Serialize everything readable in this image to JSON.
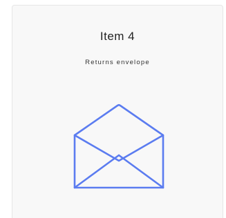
{
  "card": {
    "title": "Item 4",
    "subtitle": "Returns envelope",
    "icon": "envelope-open-icon",
    "icon_color": "#5b7cf0"
  }
}
